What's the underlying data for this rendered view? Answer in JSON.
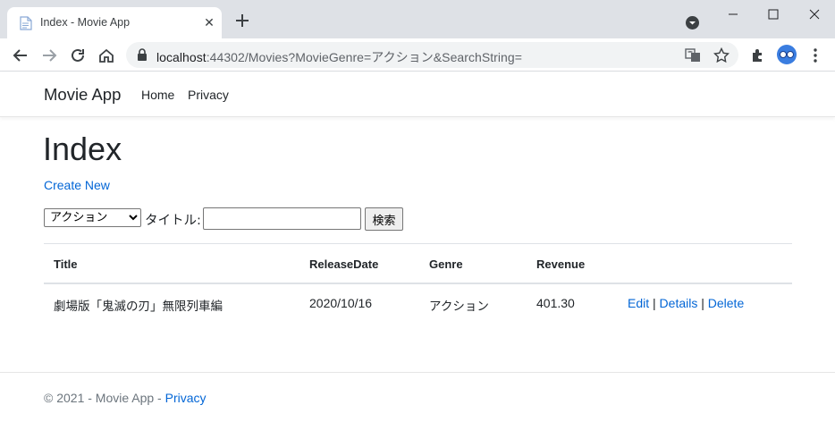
{
  "browser": {
    "tab_title": "Index - Movie App",
    "url_host": "localhost",
    "url_rest": ":44302/Movies?MovieGenre=アクション&SearchString="
  },
  "navbar": {
    "brand": "Movie App",
    "links": [
      "Home",
      "Privacy"
    ]
  },
  "main": {
    "heading": "Index",
    "create_link": "Create New",
    "filter": {
      "genre_selected": "アクション",
      "title_label": "タイトル:",
      "search_value": "",
      "search_button": "検索"
    },
    "table": {
      "headers": [
        "Title",
        "ReleaseDate",
        "Genre",
        "Revenue"
      ],
      "rows": [
        {
          "title": "劇場版「鬼滅の刃」無限列車編",
          "release_date": "2020/10/16",
          "genre": "アクション",
          "revenue": "401.30",
          "actions": [
            "Edit",
            "Details",
            "Delete"
          ],
          "separator": "|"
        }
      ]
    }
  },
  "footer": {
    "text": "© 2021 - Movie App - ",
    "link": "Privacy"
  },
  "colors": {
    "link": "#0366d6",
    "chrome_bg": "#dee1e6",
    "text": "#212529"
  }
}
